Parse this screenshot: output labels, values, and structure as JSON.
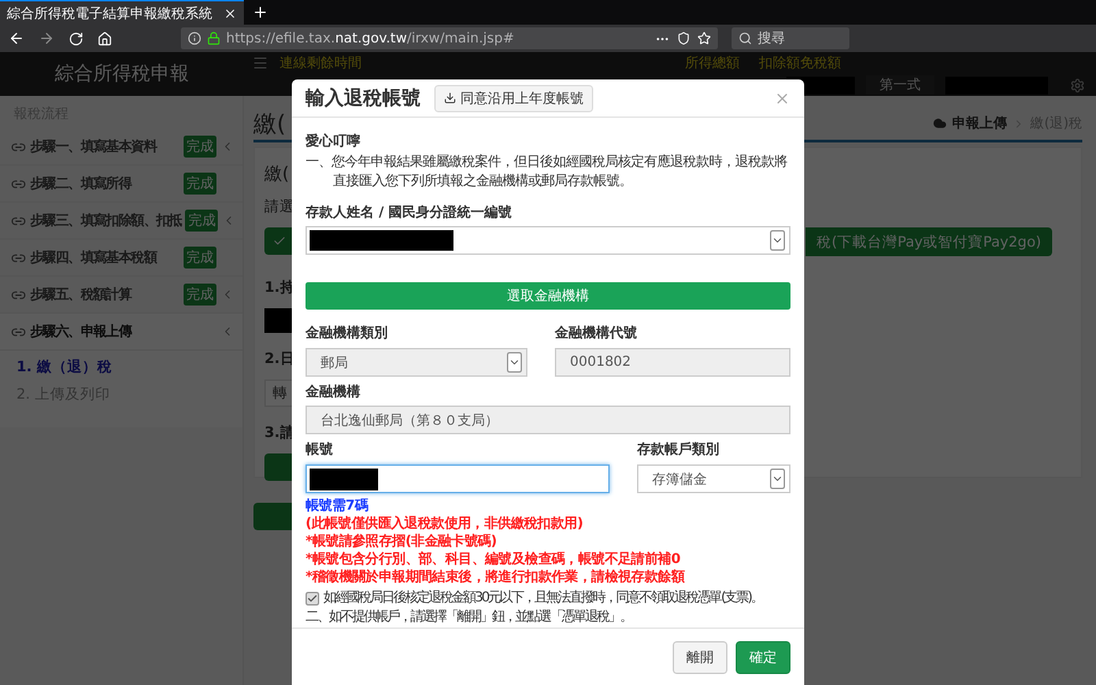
{
  "browser": {
    "tab_title": "綜合所得稅電子結算申報繳稅系統",
    "url": {
      "prefix": "https://efile.tax.",
      "domain": "nat.gov.tw",
      "path": "/irxw/main.jsp#"
    },
    "search_placeholder": "搜尋"
  },
  "app_header": {
    "title": "綜合所得稅申報",
    "timer_label": "連線剩餘時間",
    "menu": [
      "所得總額",
      "扣除額免稅額"
    ],
    "form_type": "第一式"
  },
  "sidebar": {
    "heading": "報稅流程",
    "steps": [
      {
        "label": "步驟一、填寫基本資料",
        "badge": "完成",
        "has_submenu": true,
        "selected": false
      },
      {
        "label": "步驟二、填寫所得",
        "badge": "完成",
        "has_submenu": false,
        "selected": false
      },
      {
        "label": "步驟三、填寫扣除額、扣抵",
        "badge": "完成",
        "has_submenu": true,
        "selected": false
      },
      {
        "label": "步驟四、填寫基本稅額",
        "badge": "完成",
        "has_submenu": false,
        "selected": false
      },
      {
        "label": "步驟五、稅額計算",
        "badge": "完成",
        "has_submenu": true,
        "selected": false
      },
      {
        "label": "步驟六、申報上傳",
        "has_submenu": true,
        "selected": true,
        "children": [
          {
            "label": "1. 繳（退）稅",
            "selected": true
          },
          {
            "label": "2. 上傳及列印",
            "selected": false
          }
        ]
      }
    ]
  },
  "main": {
    "heading": "繳(",
    "breadcrumb": [
      "申報上傳",
      "繳(退)稅"
    ],
    "card": {
      "title": "繳(",
      "prompt": "請選",
      "pay_button": "稅(下載台灣Pay或智付寶Pay2go)",
      "q1": "1.持",
      "q2": "2.日",
      "q2_select": "轉",
      "q3": "3.請"
    }
  },
  "modal": {
    "title": "輸入退稅帳號",
    "reuse_button": "同意沿用上年度帳號",
    "notice_title": "愛心叮嚀",
    "notice": "一、您今年申報結果雖屬繳稅案件，但日後如經國稅局核定有應退稅款時，退稅款將直接匯入您下列所填報之金融機構或郵局存款帳號。",
    "depositor": {
      "label": "存款人姓名 / 國民身分證統一編號",
      "disabled": false
    },
    "select_bank_button": "選取金融機構",
    "bank_type": {
      "label": "金融機構類別",
      "value": "郵局",
      "disabled": true
    },
    "bank_code": {
      "label": "金融機構代號",
      "value": "0001802",
      "disabled": true
    },
    "bank": {
      "label": "金融機構",
      "value": "台北逸仙郵局（第８０支局）",
      "disabled": true
    },
    "account": {
      "label": "帳號",
      "focused": true
    },
    "account_type": {
      "label": "存款帳戶類別",
      "value": "存簿儲金",
      "disabled": false
    },
    "hints": [
      {
        "text": "帳號需7碼",
        "kind": "info"
      },
      {
        "text": "(此帳號僅供匯入退稅款使用，非供繳稅扣款用)",
        "kind": "warning"
      },
      {
        "text": "*帳號請參照存摺(非金融卡號碼)",
        "kind": "warning"
      },
      {
        "text": "*帳號包含分行別、部、科目、編號及檢查碼，帳號不足請前補0",
        "kind": "warning"
      },
      {
        "text": "*稽徵機關於申報期間結束後，將進行扣款作業，請檢視存款餘額",
        "kind": "warning"
      }
    ],
    "consent": {
      "label": "如經國稅局日後核定退稅金額30元以下，且無法直撥時，同意不領取退稅憑單(支票)。",
      "checked": true
    },
    "footnote": "二、如不提供帳戶，請選擇「離開」鈕，並點選「憑單退稅」。",
    "buttons": [
      {
        "label": "離開",
        "kind": "secondary"
      },
      {
        "label": "確定",
        "kind": "primary"
      }
    ]
  }
}
